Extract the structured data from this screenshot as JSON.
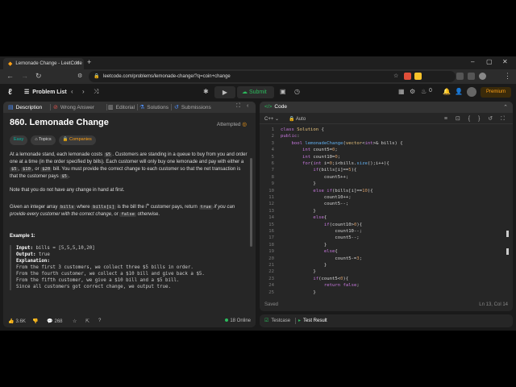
{
  "browser": {
    "tab_title": "Lemonade Change - LeetCode",
    "new_tab": "+",
    "url": "leetcode.com/problems/lemonade-change/?q=coin+change",
    "window_controls": [
      "–",
      "▢",
      "✕"
    ]
  },
  "header": {
    "problem_list_label": "Problem List",
    "submit_label": "Submit",
    "streak_count": "0",
    "premium_label": "Premium"
  },
  "left_tabs": {
    "description": "Description",
    "wrong_answer": "Wrong Answer",
    "editorial": "Editorial",
    "solutions": "Solutions",
    "submissions": "Submissions"
  },
  "problem": {
    "title": "860. Lemonade Change",
    "status": "Attempted",
    "tags": {
      "difficulty": "Easy",
      "topics": "Topics",
      "companies": "Companies"
    },
    "para1": {
      "t1": "At a lemonade stand, each lemonade costs ",
      "c1": "$5",
      "t2": ". Customers are standing in a queue to buy from you and order one at a time (in the order specified by bills). Each customer will only buy one lemonade and pay with either a ",
      "c2": "$5",
      "t3": ", ",
      "c3": "$10",
      "t4": ", or ",
      "c4": "$20",
      "t5": " bill. You must provide the correct change to each customer so that the net transaction is that the customer pays ",
      "c5": "$5",
      "t6": "."
    },
    "para2": "Note that you do not have any change in hand at first.",
    "para3": {
      "t1": "Given an integer array ",
      "c1": "bills",
      "t2": " where ",
      "c2": "bills[i]",
      "t3": " is the bill the ",
      "ith": "i",
      "sup": "th",
      "t4": " customer pays, return ",
      "c3": "true",
      "t5": " if you can provide every customer with the correct change",
      "t6": ", or ",
      "c4": "false",
      "t7": " otherwise."
    },
    "example_heading": "Example 1:",
    "example": {
      "input_label": "Input:",
      "input_value": " bills = [5,5,5,10,20]",
      "output_label": "Output:",
      "output_value": " true",
      "explanation_label": "Explanation:",
      "lines": [
        "From the first 3 customers, we collect three $5 bills in order.",
        "From the fourth customer, we collect a $10 bill and give back a $5.",
        "From the fifth customer, we give a $10 bill and a $5 bill.",
        "Since all customers got correct change, we output true."
      ]
    }
  },
  "left_footer": {
    "likes": "3.6K",
    "comments": "268",
    "online": "18 Online"
  },
  "code_panel": {
    "title": "Code",
    "language": "C++",
    "mode": "Auto",
    "status": "Saved",
    "cursor_position": "Ln 13, Col 14",
    "lines": [
      "class Solution {",
      "public:",
      "    bool lemonadeChange(vector<int>& bills) {",
      "        int count5=0;",
      "        int count10=0;",
      "        for(int i=0;i<bills.size();i++){",
      "            if(bills[i]==5){",
      "                count5++;",
      "            }",
      "            else if(bills[i]==10){",
      "                count10++;",
      "                count5--;",
      "            }",
      "            else{",
      "                if(count10>0){",
      "                    count10--;",
      "                    count5--;",
      "                }",
      "                else{",
      "                    count5-=3;",
      "                }",
      "            }",
      "            if(count5<0){",
      "                return false;",
      "            }"
    ]
  },
  "test_panel": {
    "testcase": "Testcase",
    "test_result": "Test Result"
  }
}
